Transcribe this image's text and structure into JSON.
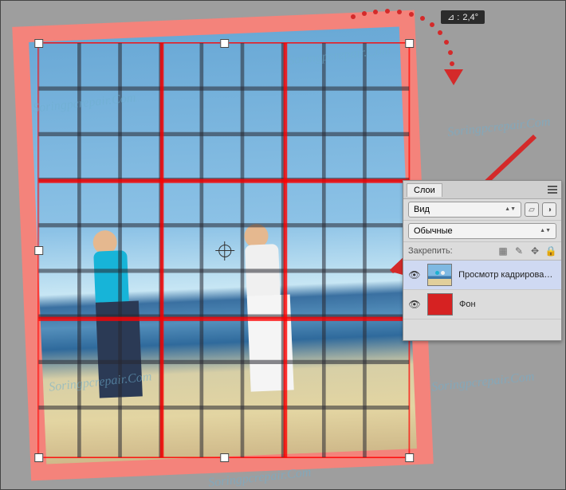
{
  "angle_tooltip": {
    "symbol": "⊿ :",
    "value": "2,4°"
  },
  "watermark_text": "Soringpcrepair.Com",
  "panel": {
    "tab_label": "Слои",
    "menu_hint": "≡",
    "view_select": "Вид",
    "blend_mode": "Обычные",
    "lock_label": "Закрепить:"
  },
  "layers": [
    {
      "name": "Просмотр кадрирования",
      "selected": true,
      "visible": true,
      "thumb": "crop"
    },
    {
      "name": "Фон",
      "selected": false,
      "visible": true,
      "thumb": "red"
    }
  ]
}
